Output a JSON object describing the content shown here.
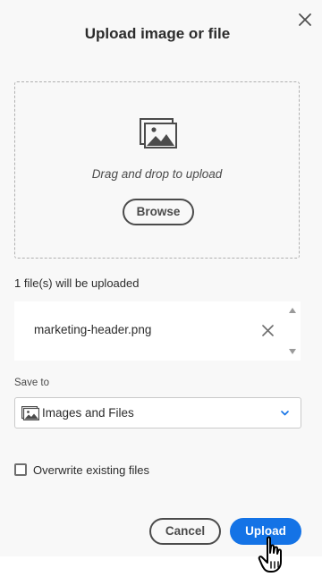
{
  "dialog": {
    "title": "Upload image or file",
    "close_icon": "close-icon"
  },
  "dropzone": {
    "icon": "image-icon",
    "instruction": "Drag and drop to upload",
    "browse_label": "Browse"
  },
  "files": {
    "count_text": "1 file(s) will be uploaded",
    "items": [
      {
        "name": "marketing-header.png",
        "remove_icon": "close-icon"
      }
    ]
  },
  "save_to": {
    "label": "Save to",
    "value": "Images and Files",
    "icon": "image-icon"
  },
  "overwrite": {
    "label": "Overwrite existing files",
    "checked": false
  },
  "actions": {
    "cancel_label": "Cancel",
    "upload_label": "Upload"
  },
  "colors": {
    "accent": "#1473e6",
    "background": "#f8f8f8",
    "text": "#2c2c2c"
  },
  "cursor": "hand-pointer-icon"
}
